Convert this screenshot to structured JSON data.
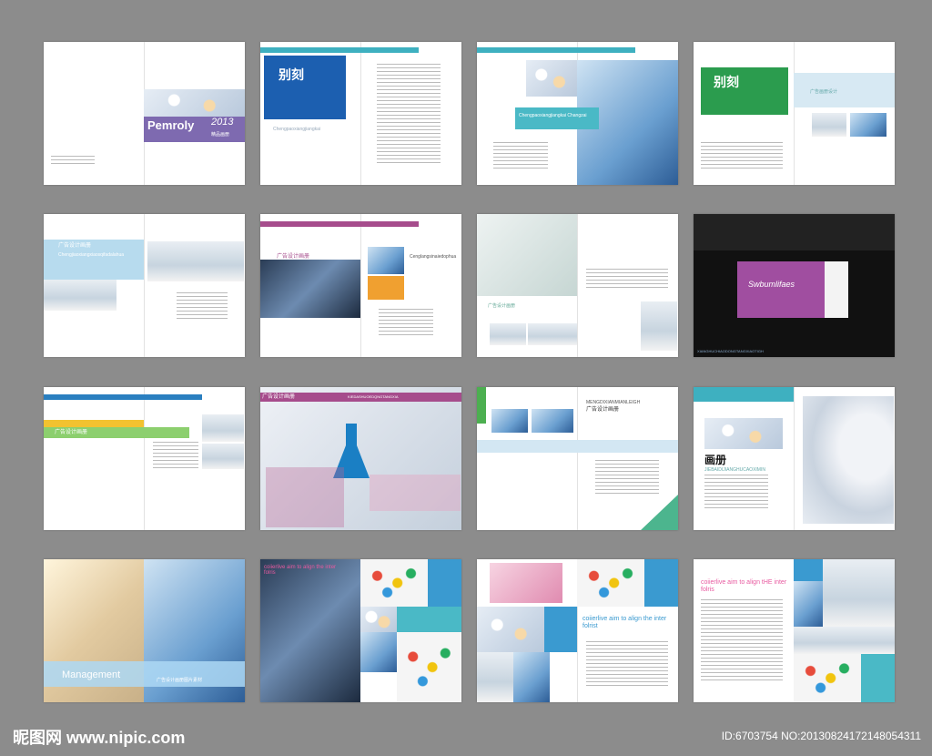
{
  "spreads": [
    {
      "brand": "Pemroly",
      "year": "2013",
      "subtitle": "精品画册"
    },
    {
      "product": "别刻",
      "caption": "Chengpaoxiangjiangkai"
    },
    {
      "caption": "Chengpaoxiangjiangkai Changzai"
    },
    {
      "product": "别刻",
      "heading": "广告画册设计"
    },
    {
      "heading": "广告设计画册",
      "sub": "Chengjiaoxiangxiaosqifadalahua"
    },
    {
      "heading": "广告设计画册",
      "sub": "Cenglangsinaiedophua"
    },
    {
      "heading": "广告设计画册"
    },
    {
      "brand": "Swbumlifaes",
      "caption": "XIANGHUCHIAODONGTANGXIAOTIGH"
    },
    {
      "heading": "广告设计画册"
    },
    {
      "heading": "广告设计画册",
      "banner": "KIEDASHUOEDQNGTANGXIA"
    },
    {
      "heading": "MENGDIXIANMIANLEIGH",
      "sub": "广告设计画册"
    },
    {
      "heading": "画册",
      "sub": "JIEBAIDIJIANGHUCAOXIMIN"
    },
    {
      "heading": "Management",
      "sub": "广告设计画册图片素材"
    },
    {
      "heading": "coiierlive aim to align the inter folris"
    },
    {
      "heading": "coiierlive aim to align the inter folrist"
    },
    {
      "heading": "coiierlive aim to align tHE inter folris"
    }
  ],
  "footer": {
    "site": "昵图网 www.nipic.com",
    "id": "ID:6703754 NO:20130824172148054311"
  }
}
